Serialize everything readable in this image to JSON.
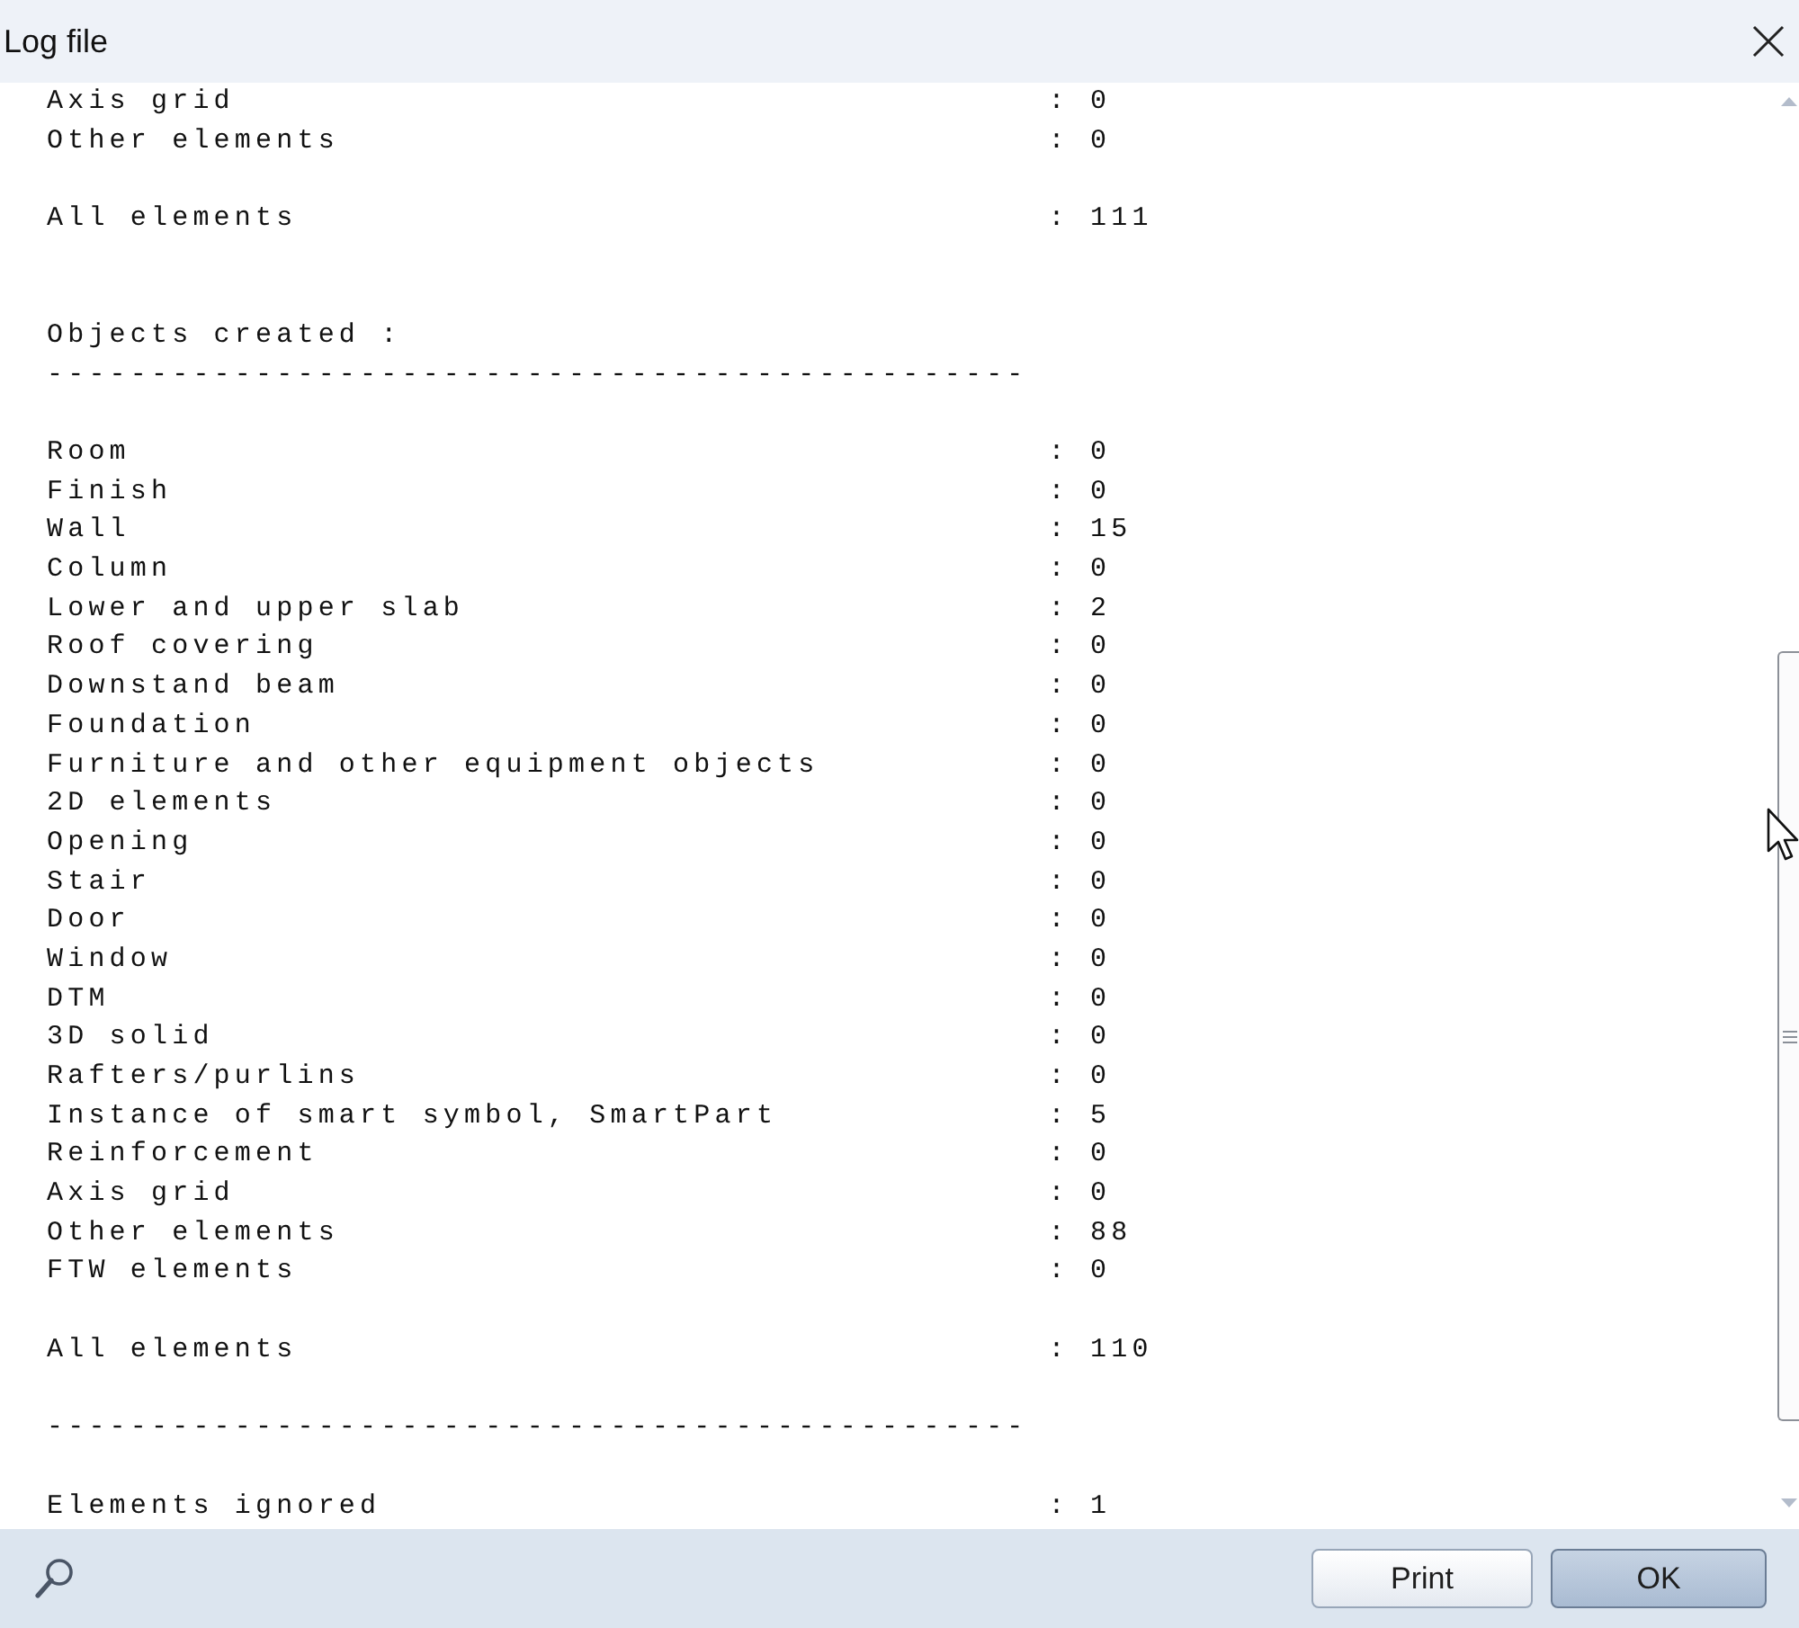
{
  "window": {
    "title": "Log file"
  },
  "log": {
    "lines": [
      {
        "kind": "entry",
        "label": "Axis grid",
        "value": ": 0"
      },
      {
        "kind": "entry",
        "label": "Other elements",
        "value": ": 0"
      },
      {
        "kind": "blank"
      },
      {
        "kind": "entry",
        "label": "All elements",
        "value": ": 111"
      },
      {
        "kind": "blank"
      },
      {
        "kind": "blank"
      },
      {
        "kind": "heading",
        "text": "Objects created :"
      },
      {
        "kind": "rule",
        "text": "-----------------------------------------------"
      },
      {
        "kind": "blank"
      },
      {
        "kind": "entry",
        "label": "Room",
        "value": ": 0"
      },
      {
        "kind": "entry",
        "label": "Finish",
        "value": ": 0"
      },
      {
        "kind": "entry",
        "label": "Wall",
        "value": ": 15"
      },
      {
        "kind": "entry",
        "label": "Column",
        "value": ": 0"
      },
      {
        "kind": "entry",
        "label": "Lower and upper slab",
        "value": ": 2"
      },
      {
        "kind": "entry",
        "label": "Roof covering",
        "value": ": 0"
      },
      {
        "kind": "entry",
        "label": "Downstand beam",
        "value": ": 0"
      },
      {
        "kind": "entry",
        "label": "Foundation",
        "value": ": 0"
      },
      {
        "kind": "entry",
        "label": "Furniture and other equipment objects",
        "value": ": 0"
      },
      {
        "kind": "entry",
        "label": "2D elements",
        "value": ": 0"
      },
      {
        "kind": "entry",
        "label": "Opening",
        "value": ": 0"
      },
      {
        "kind": "entry",
        "label": "Stair",
        "value": ": 0"
      },
      {
        "kind": "entry",
        "label": "Door",
        "value": ": 0"
      },
      {
        "kind": "entry",
        "label": "Window",
        "value": ": 0"
      },
      {
        "kind": "entry",
        "label": "DTM",
        "value": ": 0"
      },
      {
        "kind": "entry",
        "label": "3D solid",
        "value": ": 0"
      },
      {
        "kind": "entry",
        "label": "Rafters/purlins",
        "value": ": 0"
      },
      {
        "kind": "entry",
        "label": "Instance of smart symbol, SmartPart",
        "value": ": 5"
      },
      {
        "kind": "entry",
        "label": "Reinforcement",
        "value": ": 0"
      },
      {
        "kind": "entry",
        "label": "Axis grid",
        "value": ": 0"
      },
      {
        "kind": "entry",
        "label": "Other elements",
        "value": ": 88"
      },
      {
        "kind": "entry",
        "label": "FTW elements",
        "value": ": 0"
      },
      {
        "kind": "blank"
      },
      {
        "kind": "entry",
        "label": "All elements",
        "value": ": 110"
      },
      {
        "kind": "blank"
      },
      {
        "kind": "rule",
        "text": "-----------------------------------------------"
      },
      {
        "kind": "blank"
      },
      {
        "kind": "entry",
        "label": "Elements ignored",
        "value": ": 1"
      }
    ]
  },
  "footer": {
    "buttons": [
      {
        "label": "Print",
        "default": false
      },
      {
        "label": "OK",
        "default": true
      }
    ]
  }
}
